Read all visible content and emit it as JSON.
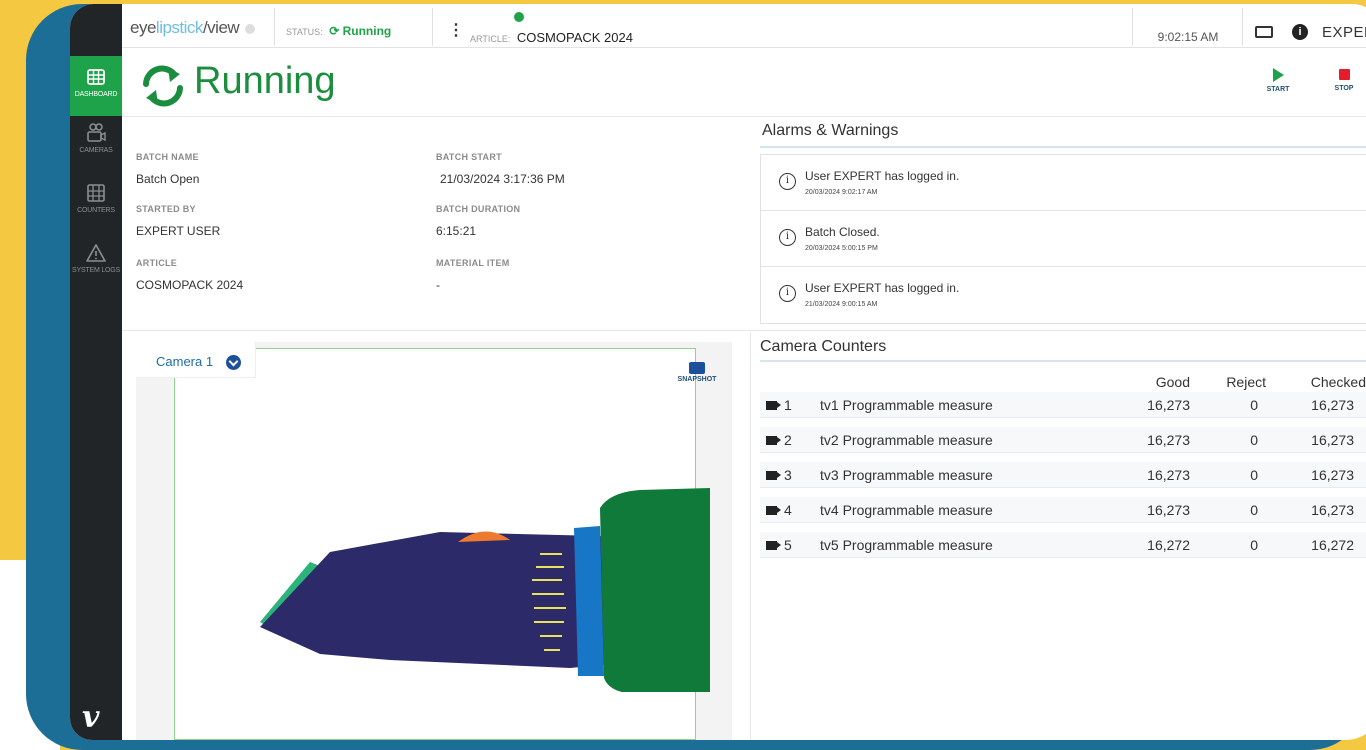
{
  "topbar": {
    "brand_prefix": "eye",
    "brand_middle": "lipstick",
    "brand_suffix": "/view",
    "status_label": "STATUS:",
    "status_value": "Running",
    "article_label": "ARTICLE:",
    "article_value": "COSMOPACK 2024",
    "time": "9:02:15 AM",
    "user": "EXPERT"
  },
  "sidebar": {
    "items": [
      {
        "label": "DASHBOARD",
        "icon": "dashboard-icon"
      },
      {
        "label": "CAMERAS",
        "icon": "cameras-icon"
      },
      {
        "label": "COUNTERS",
        "icon": "counters-icon"
      },
      {
        "label": "SYSTEM LOGS",
        "icon": "warning-icon"
      }
    ],
    "logo": "v"
  },
  "header": {
    "title": "Running",
    "start_label": "START",
    "stop_label": "STOP"
  },
  "batch": {
    "batch_name_label": "BATCH NAME",
    "batch_name": "Batch Open",
    "batch_start_label": "BATCH START",
    "batch_start": "21/03/2024 3:17:36 PM",
    "started_by_label": "STARTED BY",
    "started_by": "EXPERT USER",
    "batch_duration_label": "BATCH DURATION",
    "batch_duration": "6:15:21",
    "article_label": "ARTICLE",
    "article": "COSMOPACK 2024",
    "material_item_label": "MATERIAL ITEM",
    "material_item": "-"
  },
  "alarms": {
    "title": "Alarms & Warnings",
    "items": [
      {
        "message": "User EXPERT has logged in.",
        "time": "20/03/2024 9:02:17 AM"
      },
      {
        "message": "Batch Closed.",
        "time": "20/03/2024 5:00:15 PM"
      },
      {
        "message": "User EXPERT has logged in.",
        "time": "21/03/2024 9:00:15 AM"
      }
    ]
  },
  "camera": {
    "tab_label": "Camera 1",
    "snapshot_label": "SNAPSHOT"
  },
  "counters": {
    "title": "Camera Counters",
    "columns": [
      "Good",
      "Reject",
      "Checked"
    ],
    "rows": [
      {
        "num": "1",
        "name": "tv1 Programmable measure",
        "good": "16,273",
        "reject": "0",
        "checked": "16,273"
      },
      {
        "num": "2",
        "name": "tv2 Programmable measure",
        "good": "16,273",
        "reject": "0",
        "checked": "16,273"
      },
      {
        "num": "3",
        "name": "tv3 Programmable measure",
        "good": "16,273",
        "reject": "0",
        "checked": "16,273"
      },
      {
        "num": "4",
        "name": "tv4 Programmable measure",
        "good": "16,273",
        "reject": "0",
        "checked": "16,273"
      },
      {
        "num": "5",
        "name": "tv5 Programmable measure",
        "good": "16,272",
        "reject": "0",
        "checked": "16,272"
      }
    ]
  },
  "colors": {
    "accent_green": "#1fa34a",
    "running_green": "#1a8d3e",
    "stop_red": "#e31d2b",
    "device_blue": "#1c6e96",
    "background_yellow": "#f5c842"
  }
}
